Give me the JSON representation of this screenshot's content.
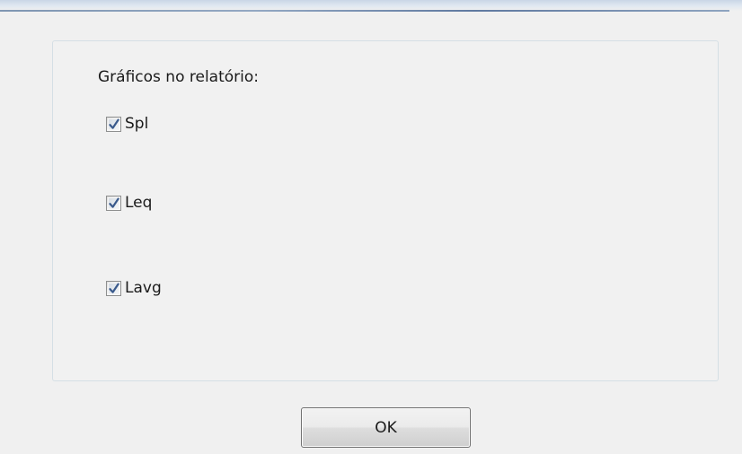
{
  "dialog": {
    "group_label": "Gráficos no relatório:",
    "checkboxes": [
      {
        "label": "Spl",
        "checked": true
      },
      {
        "label": "Leq",
        "checked": true
      },
      {
        "label": "Lavg",
        "checked": true
      }
    ],
    "ok_label": "OK"
  },
  "colors": {
    "background": "#f0f0f0",
    "check_mark": "#3a5a8c",
    "panel_border": "#d5dfe5"
  }
}
